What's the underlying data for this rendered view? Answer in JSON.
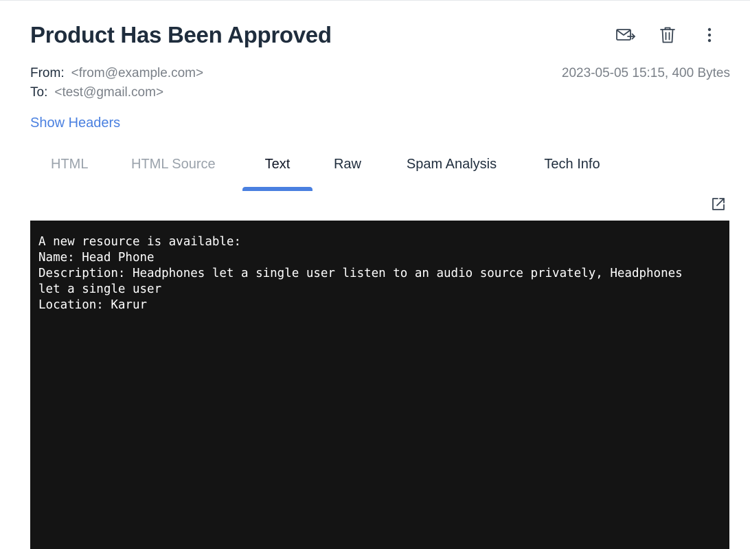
{
  "email": {
    "subject": "Product Has Been Approved",
    "from_label": "From:",
    "from_address": "<from@example.com>",
    "to_label": "To:",
    "to_address": "<test@gmail.com>",
    "date_size": "2023-05-05 15:15, 400 Bytes",
    "show_headers_label": "Show Headers"
  },
  "actions": [
    {
      "name": "forward-icon"
    },
    {
      "name": "trash-icon"
    },
    {
      "name": "more-vertical-icon"
    }
  ],
  "tabs": [
    {
      "label": "HTML",
      "state": "disabled"
    },
    {
      "label": "HTML Source",
      "state": "disabled"
    },
    {
      "label": "Text",
      "state": "active"
    },
    {
      "label": "Raw",
      "state": "normal"
    },
    {
      "label": "Spam Analysis",
      "state": "normal"
    },
    {
      "label": "Tech Info",
      "state": "normal"
    }
  ],
  "body_text": "A new resource is available:\nName: Head Phone\nDescription: Headphones let a single user listen to an audio source privately, Headphones\nlet a single user\nLocation: Karur",
  "colors": {
    "accent": "#4a80e0",
    "body_bg": "#141414",
    "title": "#1f2d3d",
    "muted": "#7a8088"
  }
}
